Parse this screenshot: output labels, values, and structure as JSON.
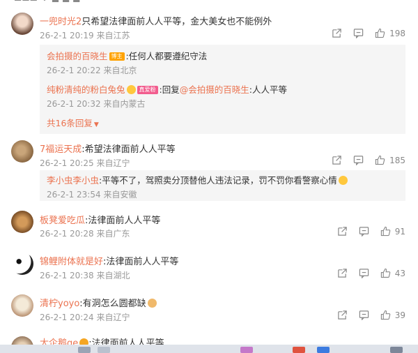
{
  "comments": [
    {
      "user": "一兜时光2",
      "text": "只希望法律面前人人平等，金大美女也不能例外",
      "time": "26-2-1 20:19",
      "location": "来自江苏",
      "likes": "198",
      "avatar": "avatar-woman",
      "replies": [
        {
          "user": "会拍摄的百晓生",
          "badge": "博主",
          "text": ":任何人都要遵纪守法",
          "time": "26-2-1 20:22",
          "location": "来自北京"
        },
        {
          "user": "纯粉清纯的粉白兔兔",
          "badge": "真爱粉",
          "text": ":回复",
          "mention": "@会拍摄的百晓生",
          "text2": ":人人平等",
          "time": "26-2-1 20:32",
          "location": "来自内蒙古"
        }
      ],
      "more_replies": "共16条回复"
    },
    {
      "user": "7福运天成",
      "text": ":希望法律面前人人平等",
      "time": "26-2-1 20:25",
      "location": "来自辽宁",
      "likes": "185",
      "avatar": "avatar-photo",
      "replies": [
        {
          "user": "李小虫李小虫",
          "text": ":平等不了，驾照卖分顶替他人违法记录，罚不罚你看警察心情",
          "time": "26-2-1 23:54",
          "location": "来自安徽"
        }
      ]
    },
    {
      "user": "板凳爱吃瓜",
      "text": ":法律面前人人平等",
      "time": "26-2-1 20:28",
      "location": "来自广东",
      "likes": "91",
      "avatar": "avatar-dog"
    },
    {
      "user": "锦鲤附体就是好",
      "text": ":法律面前人人平等",
      "time": "26-2-1 20:38",
      "location": "来自湖北",
      "likes": "43",
      "avatar": "avatar-panda"
    },
    {
      "user": "清柠yoyo",
      "text": ":有洞怎么圆都缺",
      "time": "26-2-1 20:24",
      "location": "来自辽宁",
      "likes": "39",
      "avatar": "avatar-cartoon"
    },
    {
      "user": "大企鹅ge",
      "text": ":法律面前人人平等",
      "avatar": "avatar-partial"
    }
  ],
  "colors": {
    "username": "#eb7350",
    "meta": "#999999",
    "reply_bg": "#f5f5f5"
  }
}
